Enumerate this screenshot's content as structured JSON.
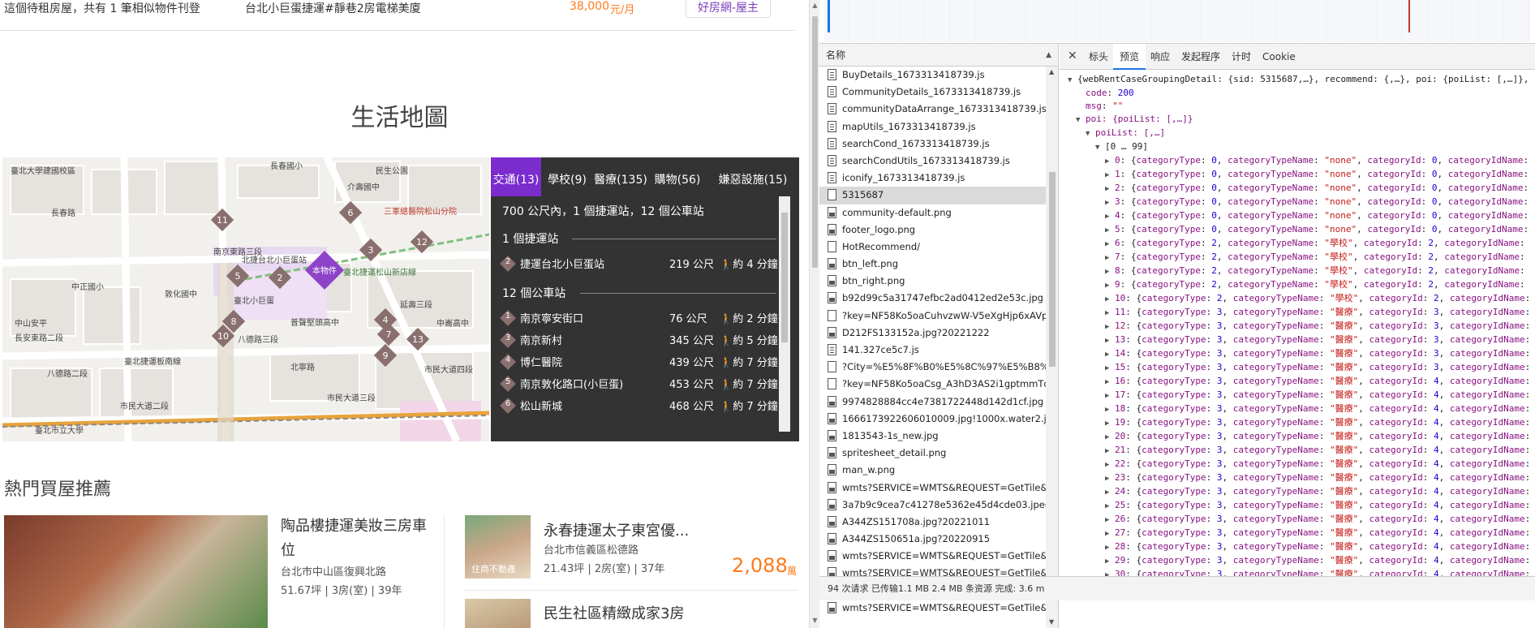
{
  "listing_top": {
    "note": "這個待租房屋，共有 1 筆相似物件刊登",
    "title": "台北小巨蛋捷運#靜巷2房電梯美廈",
    "price": "38,000",
    "price_unit": "元/月",
    "badge": "好房網-屋主"
  },
  "life_map": {
    "title": "生活地圖",
    "tabs": [
      "交通(13)",
      "學校(9)",
      "醫療(135)",
      "購物(56)",
      "嫌惡設施(15)"
    ],
    "summary": "700 公尺內，1 個捷運站，12 個公車站",
    "mrt_header": "1 個捷運站",
    "bus_header": "12 個公車站",
    "mrt_rows": [
      {
        "num": "2",
        "name": "捷運台北小巨蛋站",
        "dist": "219 公尺",
        "walk": "約 4 分鐘"
      }
    ],
    "bus_rows": [
      {
        "num": "1",
        "name": "南京寧安街口",
        "dist": "76 公尺",
        "walk": "約 2 分鐘"
      },
      {
        "num": "3",
        "name": "南京新村",
        "dist": "345 公尺",
        "walk": "約 5 分鐘"
      },
      {
        "num": "4",
        "name": "博仁醫院",
        "dist": "439 公尺",
        "walk": "約 7 分鐘"
      },
      {
        "num": "5",
        "name": "南京敦化路口(小巨蛋)",
        "dist": "453 公尺",
        "walk": "約 7 分鐘"
      },
      {
        "num": "6",
        "name": "松山新城",
        "dist": "468 公尺",
        "walk": "約 7 分鐘"
      }
    ],
    "map_marker": "本物件",
    "map_labels": [
      "臺北大學建國校區",
      "長春路",
      "北捷台北小巨蛋站",
      "中正國小",
      "敦化國中",
      "臺北小巨蛋",
      "南京東路三段",
      "中山安平",
      "長安東路二段",
      "八德路二段",
      "八德路三段",
      "市民大道二段",
      "市民大道三段",
      "三軍總醫院松山分院",
      "臺北捷運松山新店線",
      "介壽國中",
      "民生公園",
      "長春國小",
      "普聲堅頭高中",
      "中崙高中",
      "延壽三段",
      "北寧路",
      "市民大道四段",
      "臺北捷運板南線",
      "臺北市立大學"
    ],
    "map_pins": [
      "11",
      "6",
      "12",
      "3",
      "5",
      "2",
      "8",
      "10",
      "4",
      "7",
      "13",
      "9"
    ],
    "zoom_in": "+",
    "zoom_out": "−"
  },
  "hot": {
    "title": "熱門買屋推薦",
    "card1": {
      "title": "陶品樓捷運美妝三房車位",
      "addr": "台北市中山區復興北路",
      "meta": "51.67坪 | 3房(室) | 39年"
    },
    "card2": {
      "title": "永春捷運太子東宮優...",
      "addr": "台北市信義區松德路",
      "meta": "21.43坪 | 2房(室) | 37年",
      "price": "2,088",
      "unit": "萬",
      "img_label": "住商不動產"
    },
    "card3": {
      "title": "民生社區精緻成家3房"
    }
  },
  "devtools": {
    "list_header": "名称",
    "requests": [
      {
        "name": "BuyDetails_1673313418739.js",
        "type": "js"
      },
      {
        "name": "CommunityDetails_1673313418739.js",
        "type": "js"
      },
      {
        "name": "communityDataArrange_1673313418739.js",
        "type": "js"
      },
      {
        "name": "mapUtils_1673313418739.js",
        "type": "js"
      },
      {
        "name": "searchCond_1673313418739.js",
        "type": "js"
      },
      {
        "name": "searchCondUtils_1673313418739.js",
        "type": "js"
      },
      {
        "name": "iconify_1673313418739.js",
        "type": "js"
      },
      {
        "name": "5315687",
        "type": "doc"
      },
      {
        "name": "community-default.png",
        "type": "img"
      },
      {
        "name": "footer_logo.png",
        "type": "img"
      },
      {
        "name": "HotRecommend/",
        "type": "doc"
      },
      {
        "name": "btn_left.png",
        "type": "img"
      },
      {
        "name": "btn_right.png",
        "type": "img"
      },
      {
        "name": "b92d99c5a31747efbc2ad0412ed2e53c.jpg",
        "type": "img"
      },
      {
        "name": "?key=NF58Ko5oaCuhvzwW-V5eXgHjp6xAVpmT",
        "type": "doc"
      },
      {
        "name": "D212FS133152a.jpg?20221222",
        "type": "img"
      },
      {
        "name": "141.327ce5c7.js",
        "type": "js"
      },
      {
        "name": "?City=%E5%8F%B0%E5%8C%97%E5%B8%82&F",
        "type": "doc"
      },
      {
        "name": "?key=NF58Ko5oaCsg_A3hD3AS2i1gptmmTdlZk",
        "type": "doc"
      },
      {
        "name": "9974828884cc4e7381722448d142d1cf.jpg",
        "type": "img"
      },
      {
        "name": "1666173922606010009.jpg!1000x.water2.jpg",
        "type": "img"
      },
      {
        "name": "1813543-1s_new.jpg",
        "type": "img"
      },
      {
        "name": "spritesheet_detail.png",
        "type": "img"
      },
      {
        "name": "man_w.png",
        "type": "img"
      },
      {
        "name": "wmts?SERVICE=WMTS&REQUEST=GetTile&VER",
        "type": "img"
      },
      {
        "name": "3a7b9c9cea7c41278e5362e45d4cde03.jpeg",
        "type": "img"
      },
      {
        "name": "A344ZS151708a.jpg?20221011",
        "type": "img"
      },
      {
        "name": "A344ZS150651a.jpg?20220915",
        "type": "img"
      },
      {
        "name": "wmts?SERVICE=WMTS&REQUEST=GetTile&VER",
        "type": "img"
      },
      {
        "name": "wmts?SERVICE=WMTS&REQUEST=GetTile&VER",
        "type": "img"
      },
      {
        "name": "wmts?SERVICE=WMTS&REQUEST=GetTile&VER",
        "type": "img"
      },
      {
        "name": "wmts?SERVICE=WMTS&REQUEST=GetTile&VER",
        "type": "img"
      }
    ],
    "selected_request": "5315687",
    "tabs": [
      "标头",
      "预览",
      "响应",
      "发起程序",
      "计时",
      "Cookie"
    ],
    "active_tab": "预览",
    "status": "94 次请求  已传输1.1 MB  2.4 MB 条资源  完成: 3.6 m",
    "json_root": "{webRentCaseGroupingDetail: {sid: 5315687,…}, recommend: {,…}, poi: {poiList: [,…]},",
    "code_key": "code",
    "code_val": "200",
    "msg_key": "msg",
    "msg_val": "\"\"",
    "poi_line": "poi: {poiList: [,…]}",
    "poilist_line": "poiList: [,…]",
    "range_line": "[0 … 99]",
    "items": [
      {
        "i": "0",
        "t": "0",
        "n": "\"none\"",
        "c": "0"
      },
      {
        "i": "1",
        "t": "0",
        "n": "\"none\"",
        "c": "0"
      },
      {
        "i": "2",
        "t": "0",
        "n": "\"none\"",
        "c": "0"
      },
      {
        "i": "3",
        "t": "0",
        "n": "\"none\"",
        "c": "0"
      },
      {
        "i": "4",
        "t": "0",
        "n": "\"none\"",
        "c": "0"
      },
      {
        "i": "5",
        "t": "0",
        "n": "\"none\"",
        "c": "0"
      },
      {
        "i": "6",
        "t": "2",
        "n": "\"學校\"",
        "c": "2"
      },
      {
        "i": "7",
        "t": "2",
        "n": "\"學校\"",
        "c": "2"
      },
      {
        "i": "8",
        "t": "2",
        "n": "\"學校\"",
        "c": "2"
      },
      {
        "i": "9",
        "t": "2",
        "n": "\"學校\"",
        "c": "2"
      },
      {
        "i": "10",
        "t": "2",
        "n": "\"學校\"",
        "c": "2"
      },
      {
        "i": "11",
        "t": "3",
        "n": "\"醫療\"",
        "c": "3"
      },
      {
        "i": "12",
        "t": "3",
        "n": "\"醫療\"",
        "c": "3"
      },
      {
        "i": "13",
        "t": "3",
        "n": "\"醫療\"",
        "c": "3"
      },
      {
        "i": "14",
        "t": "3",
        "n": "\"醫療\"",
        "c": "3"
      },
      {
        "i": "15",
        "t": "3",
        "n": "\"醫療\"",
        "c": "3"
      },
      {
        "i": "16",
        "t": "3",
        "n": "\"醫療\"",
        "c": "4"
      },
      {
        "i": "17",
        "t": "3",
        "n": "\"醫療\"",
        "c": "4"
      },
      {
        "i": "18",
        "t": "3",
        "n": "\"醫療\"",
        "c": "4"
      },
      {
        "i": "19",
        "t": "3",
        "n": "\"醫療\"",
        "c": "4"
      },
      {
        "i": "20",
        "t": "3",
        "n": "\"醫療\"",
        "c": "4"
      },
      {
        "i": "21",
        "t": "3",
        "n": "\"醫療\"",
        "c": "4"
      },
      {
        "i": "22",
        "t": "3",
        "n": "\"醫療\"",
        "c": "4"
      },
      {
        "i": "23",
        "t": "3",
        "n": "\"醫療\"",
        "c": "4"
      },
      {
        "i": "24",
        "t": "3",
        "n": "\"醫療\"",
        "c": "4"
      },
      {
        "i": "25",
        "t": "3",
        "n": "\"醫療\"",
        "c": "4"
      },
      {
        "i": "26",
        "t": "3",
        "n": "\"醫療\"",
        "c": "4"
      },
      {
        "i": "27",
        "t": "3",
        "n": "\"醫療\"",
        "c": "4"
      },
      {
        "i": "28",
        "t": "3",
        "n": "\"醫療\"",
        "c": "4"
      },
      {
        "i": "29",
        "t": "3",
        "n": "\"醫療\"",
        "c": "4"
      },
      {
        "i": "30",
        "t": "3",
        "n": "\"醫療\"",
        "c": "4"
      },
      {
        "i": "31",
        "t": "3",
        "n": "\"醫療\"",
        "c": "4"
      },
      {
        "i": "32",
        "t": "3",
        "n": "\"醫療\"",
        "c": "4"
      },
      {
        "i": "33",
        "t": "3",
        "n": "\"醫療\"",
        "c": "4"
      },
      {
        "i": "34",
        "t": "3",
        "n": "\"醫療\"",
        "c": "4"
      },
      {
        "i": "35",
        "t": "3",
        "n": "\"醫療\"",
        "c": "4"
      }
    ],
    "colors": {
      "accent": "#7b2ccd",
      "price": "#ff7a1a",
      "json_key": "#881280",
      "json_num": "#1c00cf",
      "json_str": "#c41a16"
    }
  }
}
